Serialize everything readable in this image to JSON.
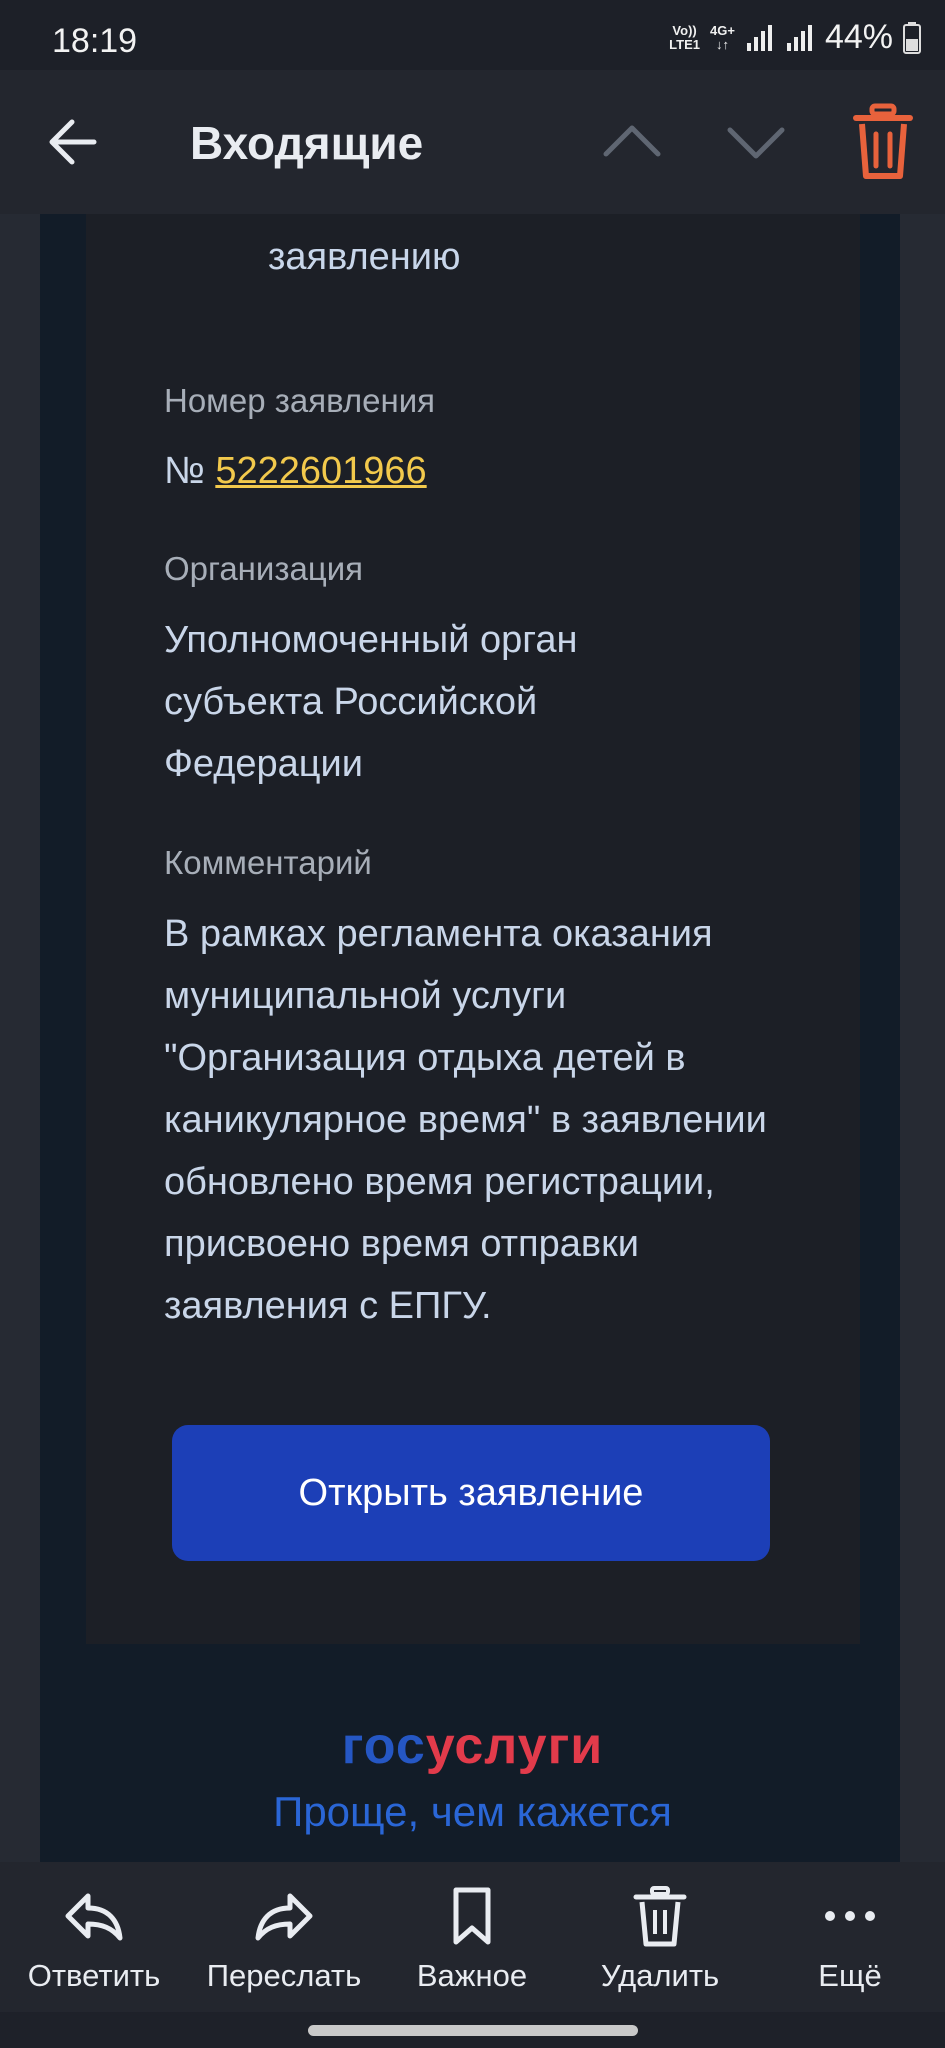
{
  "status": {
    "time": "18:19",
    "volte_top": "Vo))",
    "volte_bottom": "LTE1",
    "network": "4G+",
    "battery": "44%"
  },
  "header": {
    "title": "Входящие"
  },
  "message": {
    "prev_fragment": "заявлению",
    "fields": [
      {
        "label": "Номер заявления",
        "prefix": "№",
        "value": "5222601966"
      },
      {
        "label": "Организация",
        "value": "Уполномоченный орган субъекта Российской Федерации"
      },
      {
        "label": "Комментарий",
        "value": "В рамках регламента оказания муниципальной услуги \"Организация отдыха детей в каникулярное время\" в заявлении обновлено время регистрации, присвоено время отправки заявления с ЕПГУ."
      }
    ],
    "open_button": "Открыть заявление",
    "brand": {
      "part1": "гос",
      "part2": "услуги",
      "slogan": "Проще, чем кажется"
    }
  },
  "bottom_bar": {
    "reply": "Ответить",
    "forward": "Переслать",
    "important": "Важное",
    "delete": "Удалить",
    "more": "Ещё"
  },
  "colors": {
    "accent_link": "#f2c94c",
    "button": "#1c3fb7",
    "trash": "#e8623c"
  }
}
